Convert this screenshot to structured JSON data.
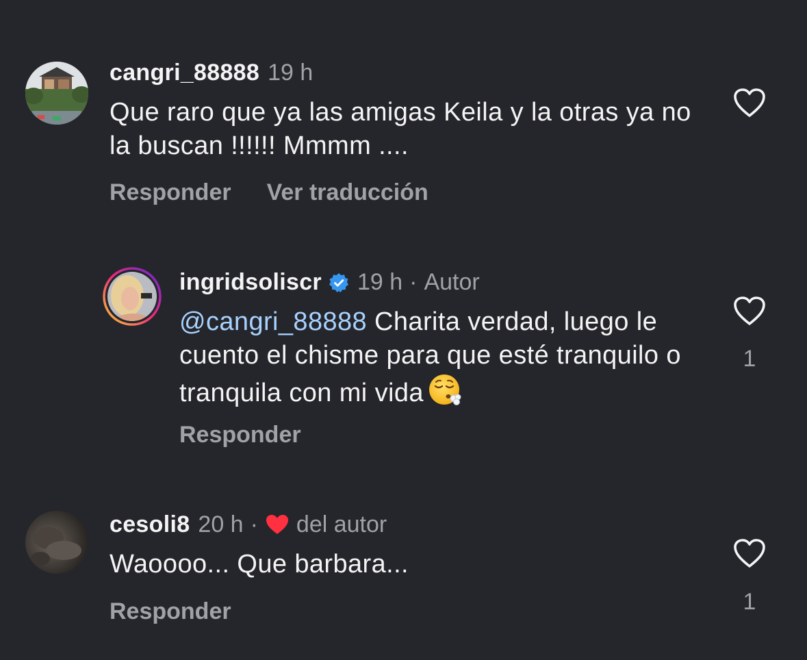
{
  "comments": [
    {
      "username": "cangri_88888",
      "time": "19 h",
      "text": "Que raro que ya las amigas Keila y la otras ya no la buscan !!!!!! Mmmm ....",
      "reply_label": "Responder",
      "translate_label": "Ver traducción",
      "likes": ""
    },
    {
      "username": "ingridsoliscr",
      "verified": true,
      "time": "19 h",
      "author_badge": "Autor",
      "mention": "@cangri_88888",
      "text": " Charita verdad, luego le cuento el chisme para que esté tranquilo o tranquila con mi vida",
      "emoji": "face-exhaling-emoji",
      "reply_label": "Responder",
      "likes": "1"
    },
    {
      "username": "cesoli8",
      "time": "20 h",
      "liked_by_author": "del autor",
      "text": "Waoooo... Que barbara...",
      "reply_label": "Responder",
      "likes": "1"
    }
  ],
  "colors": {
    "background": "#25262b",
    "text": "#f4f4f5",
    "secondary": "#a1a2a8",
    "mention": "#a8d2ff",
    "verified": "#3797f0",
    "heart": "#ff3040"
  }
}
